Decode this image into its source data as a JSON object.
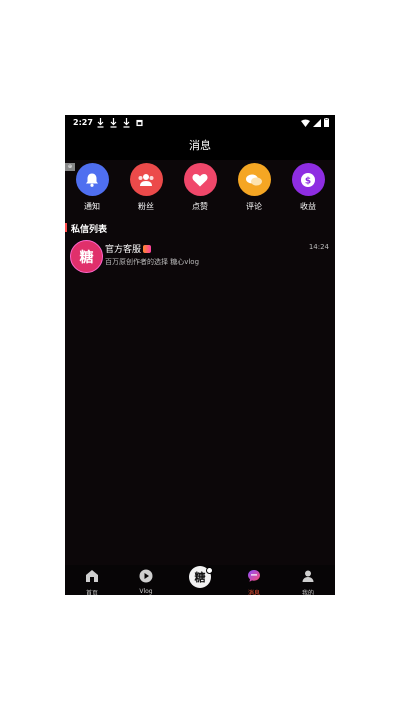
{
  "status": {
    "time": "2:27"
  },
  "header": {
    "title": "消息"
  },
  "categories": [
    {
      "label": "通知",
      "icon": "bell-icon",
      "color": "#4f6ff0"
    },
    {
      "label": "粉丝",
      "icon": "users-icon",
      "color": "#ec4a4a"
    },
    {
      "label": "点赞",
      "icon": "heart-icon",
      "color": "#f0476a"
    },
    {
      "label": "评论",
      "icon": "comment-icon",
      "color": "#f5a623"
    },
    {
      "label": "收益",
      "icon": "dollar-icon",
      "color": "#8e2de2"
    }
  ],
  "section": {
    "title": "私信列表"
  },
  "messages": [
    {
      "avatar_text": "糖",
      "name": "官方客服",
      "preview": "百万原创作者的选择 糖心vlog",
      "time": "14:24"
    }
  ],
  "tabbar": {
    "items": [
      {
        "label": "首页",
        "icon": "home-icon"
      },
      {
        "label": "Vlog",
        "icon": "play-icon"
      },
      {
        "label": "",
        "icon": "center-logo-icon",
        "glyph": "糖"
      },
      {
        "label": "消息",
        "icon": "message-icon",
        "active": true
      },
      {
        "label": "我的",
        "icon": "profile-icon"
      }
    ]
  },
  "colors": {
    "background": "#0c0709",
    "accent": "#ff5a3c"
  }
}
